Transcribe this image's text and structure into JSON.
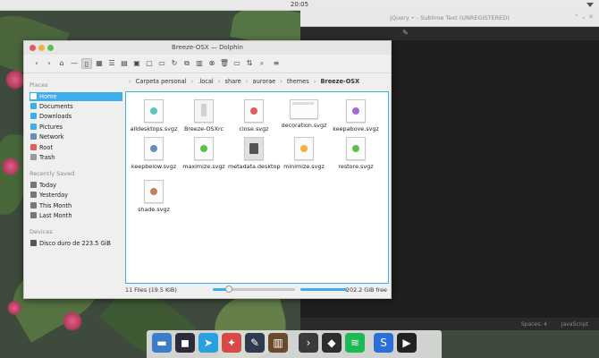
{
  "topbar": {
    "clock": "20:05"
  },
  "sublime": {
    "title": "jQuery • - Sublime Text (UNREGISTERED)",
    "status_left": "Spaces: 4",
    "status_right": "JavaScript"
  },
  "dolphin": {
    "title": "Breeze-OSX — Dolphin",
    "places_label": "Places",
    "places": [
      "Home",
      "Documents",
      "Downloads",
      "Pictures",
      "Network",
      "Root",
      "Trash"
    ],
    "recent_label": "Recently Saved",
    "recent": [
      "Today",
      "Yesterday",
      "This Month",
      "Last Month"
    ],
    "devices_label": "Devices",
    "devices": [
      "Disco duro de 223.5 GiB"
    ],
    "breadcrumb": [
      "Carpeta personal",
      ".local",
      "share",
      "aurorae",
      "themes",
      "Breeze-OSX"
    ],
    "files": [
      {
        "name": "alldesktops.svgz"
      },
      {
        "name": "Breeze-OSXrc"
      },
      {
        "name": "close.svgz"
      },
      {
        "name": "decoration.svgz"
      },
      {
        "name": "keepabove.svgz"
      },
      {
        "name": "keepbelow.svgz"
      },
      {
        "name": "maximize.svgz"
      },
      {
        "name": "metadata.desktop"
      },
      {
        "name": "minimize.svgz"
      },
      {
        "name": "restore.svgz"
      },
      {
        "name": "shade.svgz"
      }
    ],
    "status_count": "11 Files (19.5 KiB)",
    "status_free": "202.2 GiB free",
    "zoom_fraction": 0.2
  },
  "colors": {
    "accent": "#3daee9",
    "close_dot": "#e45b5b",
    "min_dot": "#f0b23c",
    "max_dot": "#5fbf4a"
  }
}
